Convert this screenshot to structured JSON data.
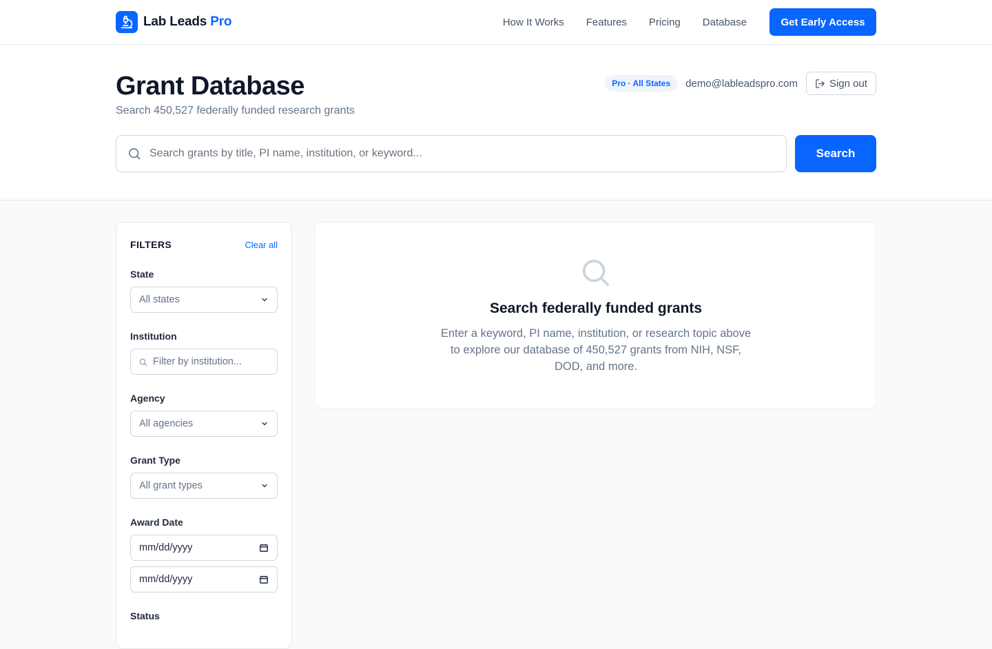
{
  "nav": {
    "brand_name": "Lab Leads",
    "brand_accent": "Pro",
    "links": [
      "How It Works",
      "Features",
      "Pricing",
      "Database"
    ],
    "cta_label": "Get Early Access"
  },
  "header": {
    "title": "Grant Database",
    "subtitle": "Search 450,527 federally funded research grants",
    "plan_badge": "Pro · All States",
    "email": "demo@lableadspro.com",
    "signout_label": "Sign out"
  },
  "search": {
    "placeholder": "Search grants by title, PI name, institution, or keyword...",
    "value": "",
    "button_label": "Search"
  },
  "filters": {
    "title": "FILTERS",
    "clear_label": "Clear all",
    "state": {
      "label": "State",
      "value": "All states"
    },
    "institution": {
      "label": "Institution",
      "placeholder": "Filter by institution..."
    },
    "agency": {
      "label": "Agency",
      "value": "All agencies"
    },
    "grant_type": {
      "label": "Grant Type",
      "value": "All grant types"
    },
    "award_date": {
      "label": "Award Date",
      "from": "mm/dd/yyyy",
      "to": "mm/dd/yyyy"
    },
    "status": {
      "label": "Status"
    }
  },
  "empty_state": {
    "title": "Search federally funded grants",
    "text": "Enter a keyword, PI name, institution, or research topic above to explore our database of 450,527 grants from NIH, NSF, DOD, and more."
  },
  "colors": {
    "accent": "#0866ff",
    "page_bg": "#f8fafc",
    "text_primary": "#0f172a",
    "text_muted": "#64748b",
    "border": "#e5e7eb"
  },
  "icons": {
    "brand": "microscope-icon",
    "signout": "sign-out-icon",
    "search": "search-icon",
    "select": "chevron-down-icon",
    "date": "calendar-icon"
  }
}
